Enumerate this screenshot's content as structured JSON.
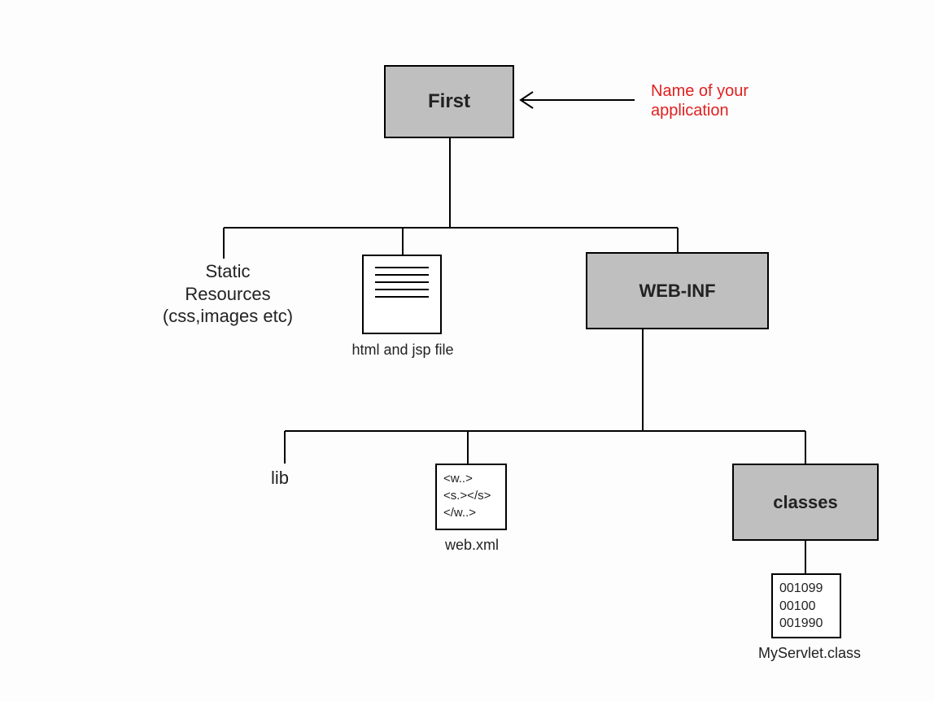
{
  "root": {
    "label": "First"
  },
  "annotation": {
    "line1": "Name of your",
    "line2": "application"
  },
  "static_resources": {
    "line1": "Static",
    "line2": "Resources",
    "line3": "(css,images etc)"
  },
  "html_jsp": {
    "caption": "html and jsp file"
  },
  "webinf": {
    "label": "WEB-INF"
  },
  "lib": {
    "label": "lib"
  },
  "webxml": {
    "line1": "<w..>",
    "line2": "<s.></s>",
    "line3": "</w..>",
    "caption": "web.xml"
  },
  "classes": {
    "label": "classes"
  },
  "servlet": {
    "line1": "001099",
    "line2": "00100",
    "line3": "001990",
    "caption": "MyServlet.class"
  }
}
